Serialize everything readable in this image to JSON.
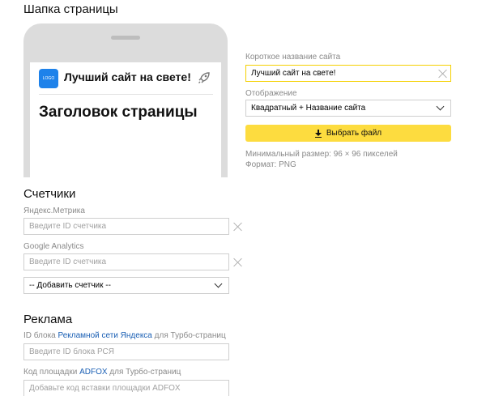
{
  "header_section": {
    "title": "Шапка страницы"
  },
  "preview": {
    "logo_text": "LOGO",
    "site_name": "Лучший сайт на свете!",
    "page_heading": "Заголовок страницы"
  },
  "short_name": {
    "label": "Короткое название сайта",
    "value": "Лучший сайт на свете!"
  },
  "display": {
    "label": "Отображение",
    "selected": "Квадратный + Название сайта"
  },
  "upload": {
    "button_label": "Выбрать файл",
    "hint_size": "Минимальный размер: 96 × 96 пикселей",
    "hint_format": "Формат: PNG"
  },
  "counters": {
    "title": "Счетчики",
    "metrika_label": "Яндекс.Метрика",
    "metrika_placeholder": "Введите ID счетчика",
    "ga_label": "Google Analytics",
    "ga_placeholder": "Введите ID счетчика",
    "add_select": "-- Добавить счетчик --"
  },
  "ads": {
    "title": "Реклама",
    "rsya_label_pre": "ID блока ",
    "rsya_link": "Рекламной сети Яндекса",
    "rsya_label_post": " для Турбо-страниц",
    "rsya_placeholder": "Введите ID блока РСЯ",
    "adfox_label_pre": "Код площадки ",
    "adfox_link": "ADFOX",
    "adfox_label_post": " для Турбо-страниц",
    "adfox_placeholder": "Добавьте код вставки площадки ADFOX"
  },
  "colors": {
    "accent_yellow": "#fddc3f",
    "logo_blue": "#1e82ea",
    "link_blue": "#1a5fb4"
  }
}
